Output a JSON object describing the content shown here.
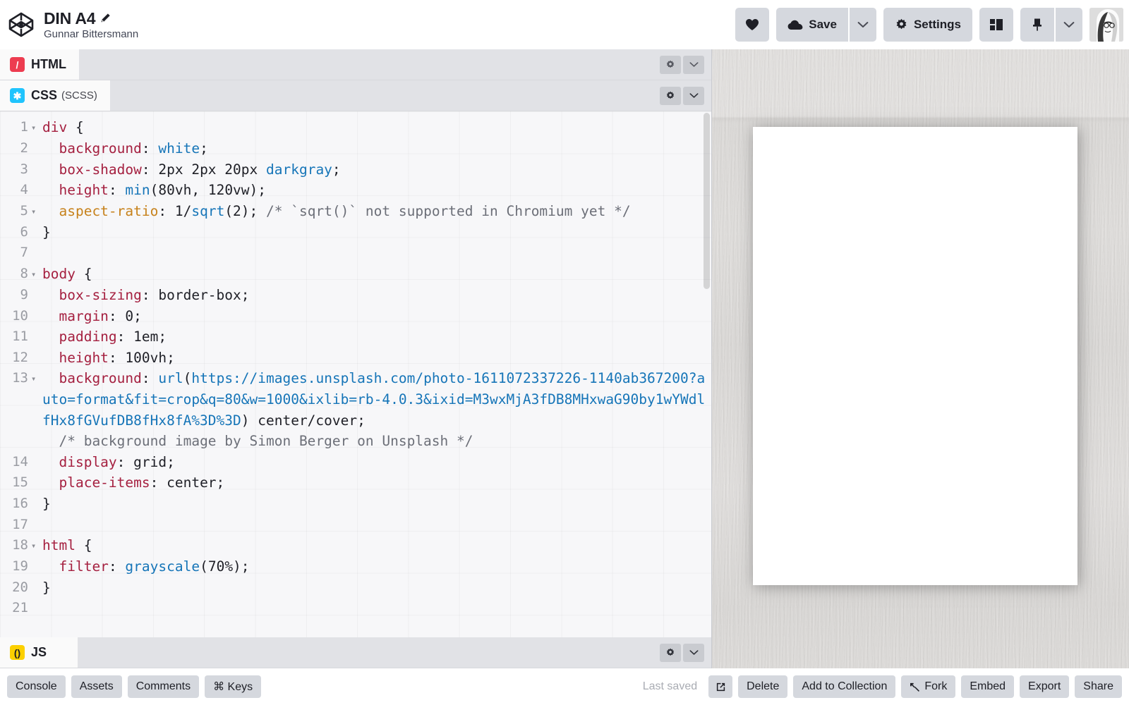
{
  "header": {
    "logo_icon": "codepen-logo-icon",
    "pen_title": "DIN A4",
    "pen_title_edit_icon": "pencil-icon",
    "pen_author": "Gunnar Bittersmann",
    "actions": {
      "love_label": "",
      "love_icon": "heart-icon",
      "save_label": "Save",
      "save_icon": "cloud-icon",
      "save_caret_icon": "chevron-down-icon",
      "settings_label": "Settings",
      "settings_icon": "gear-icon",
      "layout_icon": "layout-panels-icon",
      "pin_icon": "pin-icon",
      "pin_caret_icon": "chevron-down-icon",
      "avatar_icon": "user-avatar"
    }
  },
  "editors": {
    "panes": [
      {
        "id": "html",
        "label": "HTML",
        "sublabel": "",
        "icon": "html-logo-icon",
        "settings_icon": "gear-icon",
        "collapse_icon": "chevron-down-icon"
      },
      {
        "id": "css",
        "label": "CSS",
        "sublabel": "(SCSS)",
        "icon": "css-logo-icon",
        "settings_icon": "gear-icon",
        "collapse_icon": "chevron-down-icon"
      },
      {
        "id": "js",
        "label": "JS",
        "sublabel": "",
        "icon": "js-logo-icon",
        "settings_icon": "gear-icon",
        "collapse_icon": "chevron-down-icon"
      }
    ],
    "css_code": {
      "language": "SCSS",
      "total_lines": 21,
      "lines": [
        {
          "n": 1,
          "fold": true,
          "tokens": [
            {
              "t": "div",
              "c": "k-sel"
            },
            {
              "t": " {",
              "c": "k-punc"
            }
          ]
        },
        {
          "n": 2,
          "fold": false,
          "tokens": [
            {
              "t": "  ",
              "c": "k-punc"
            },
            {
              "t": "background",
              "c": "k-prop"
            },
            {
              "t": ": ",
              "c": "k-punc"
            },
            {
              "t": "white",
              "c": "k-val"
            },
            {
              "t": ";",
              "c": "k-punc"
            }
          ]
        },
        {
          "n": 3,
          "fold": false,
          "tokens": [
            {
              "t": "  ",
              "c": "k-punc"
            },
            {
              "t": "box-shadow",
              "c": "k-prop"
            },
            {
              "t": ": 2px 2px 20px ",
              "c": "k-punc"
            },
            {
              "t": "darkgray",
              "c": "k-val"
            },
            {
              "t": ";",
              "c": "k-punc"
            }
          ]
        },
        {
          "n": 4,
          "fold": false,
          "tokens": [
            {
              "t": "  ",
              "c": "k-punc"
            },
            {
              "t": "height",
              "c": "k-prop"
            },
            {
              "t": ": ",
              "c": "k-punc"
            },
            {
              "t": "min",
              "c": "k-val"
            },
            {
              "t": "(80vh, 120vw);",
              "c": "k-punc"
            }
          ]
        },
        {
          "n": 5,
          "fold": true,
          "tokens": [
            {
              "t": "  ",
              "c": "k-punc"
            },
            {
              "t": "aspect-ratio",
              "c": "k-propu"
            },
            {
              "t": ": 1/",
              "c": "k-punc"
            },
            {
              "t": "sqrt",
              "c": "k-val"
            },
            {
              "t": "(2); ",
              "c": "k-punc"
            },
            {
              "t": "/* `sqrt()` not supported in Chromium yet */",
              "c": "k-com"
            }
          ]
        },
        {
          "n": 6,
          "fold": false,
          "tokens": [
            {
              "t": "}",
              "c": "k-punc"
            }
          ]
        },
        {
          "n": 7,
          "fold": false,
          "tokens": []
        },
        {
          "n": 8,
          "fold": true,
          "tokens": [
            {
              "t": "body",
              "c": "k-sel"
            },
            {
              "t": " {",
              "c": "k-punc"
            }
          ]
        },
        {
          "n": 9,
          "fold": false,
          "tokens": [
            {
              "t": "  ",
              "c": "k-punc"
            },
            {
              "t": "box-sizing",
              "c": "k-prop"
            },
            {
              "t": ": border-box;",
              "c": "k-punc"
            }
          ]
        },
        {
          "n": 10,
          "fold": false,
          "tokens": [
            {
              "t": "  ",
              "c": "k-punc"
            },
            {
              "t": "margin",
              "c": "k-prop"
            },
            {
              "t": ": 0;",
              "c": "k-punc"
            }
          ]
        },
        {
          "n": 11,
          "fold": false,
          "tokens": [
            {
              "t": "  ",
              "c": "k-punc"
            },
            {
              "t": "padding",
              "c": "k-prop"
            },
            {
              "t": ": 1em;",
              "c": "k-punc"
            }
          ]
        },
        {
          "n": 12,
          "fold": false,
          "tokens": [
            {
              "t": "  ",
              "c": "k-punc"
            },
            {
              "t": "height",
              "c": "k-prop"
            },
            {
              "t": ": 100vh;",
              "c": "k-punc"
            }
          ]
        },
        {
          "n": 13,
          "fold": true,
          "tokens": [
            {
              "t": "  ",
              "c": "k-punc"
            },
            {
              "t": "background",
              "c": "k-prop"
            },
            {
              "t": ": ",
              "c": "k-punc"
            },
            {
              "t": "url",
              "c": "k-val"
            },
            {
              "t": "(",
              "c": "k-punc"
            },
            {
              "t": "https://images.unsplash.com/photo-1611072337226-1140ab367200?auto=format&fit=crop&q=80&w=1000&ixlib=rb-4.0.3&ixid=M3wxMjA3fDB8MHxwaG90by1wYWdlfHx8fGVufDB8fHx8fA%3D%3D",
              "c": "k-url"
            },
            {
              "t": ") center/cover;",
              "c": "k-punc"
            }
          ]
        },
        {
          "n": null,
          "fold": false,
          "tokens": [
            {
              "t": "  /* background image by Simon Berger on Unsplash */",
              "c": "k-com"
            }
          ]
        },
        {
          "n": 14,
          "fold": false,
          "tokens": [
            {
              "t": "  ",
              "c": "k-punc"
            },
            {
              "t": "display",
              "c": "k-prop"
            },
            {
              "t": ": grid;",
              "c": "k-punc"
            }
          ]
        },
        {
          "n": 15,
          "fold": false,
          "tokens": [
            {
              "t": "  ",
              "c": "k-punc"
            },
            {
              "t": "place-items",
              "c": "k-prop"
            },
            {
              "t": ": center;",
              "c": "k-punc"
            }
          ]
        },
        {
          "n": 16,
          "fold": false,
          "tokens": [
            {
              "t": "}",
              "c": "k-punc"
            }
          ]
        },
        {
          "n": 17,
          "fold": false,
          "tokens": []
        },
        {
          "n": 18,
          "fold": true,
          "tokens": [
            {
              "t": "html",
              "c": "k-sel"
            },
            {
              "t": " {",
              "c": "k-punc"
            }
          ]
        },
        {
          "n": 19,
          "fold": false,
          "tokens": [
            {
              "t": "  ",
              "c": "k-punc"
            },
            {
              "t": "filter",
              "c": "k-prop"
            },
            {
              "t": ": ",
              "c": "k-punc"
            },
            {
              "t": "grayscale",
              "c": "k-val"
            },
            {
              "t": "(70%);",
              "c": "k-punc"
            }
          ]
        },
        {
          "n": 20,
          "fold": false,
          "tokens": [
            {
              "t": "}",
              "c": "k-punc"
            }
          ]
        },
        {
          "n": 21,
          "fold": false,
          "tokens": []
        }
      ]
    }
  },
  "preview": {
    "description": "white A4 page sheet centered on grayscale wood background",
    "sheet_color": "#ffffff",
    "background_color": "#e6e0dc"
  },
  "footer": {
    "left_buttons": [
      {
        "label": "Console",
        "icon": ""
      },
      {
        "label": "Assets",
        "icon": ""
      },
      {
        "label": "Comments",
        "icon": ""
      },
      {
        "label": "⌘ Keys",
        "icon": "command-icon"
      }
    ],
    "last_saved": "Last saved",
    "right_buttons": [
      {
        "label": "",
        "icon": "external-link-icon"
      },
      {
        "label": "Delete",
        "icon": ""
      },
      {
        "label": "Add to Collection",
        "icon": ""
      },
      {
        "label": "Fork",
        "icon": "fork-icon"
      },
      {
        "label": "Embed",
        "icon": ""
      },
      {
        "label": "Export",
        "icon": ""
      },
      {
        "label": "Share",
        "icon": ""
      }
    ]
  },
  "colors": {
    "toolbar_button": "#d5d8de",
    "editor_bg": "#f7f7f9",
    "html_accent": "#ed3c50",
    "css_accent": "#20c4fd",
    "js_accent": "#fcd000",
    "selector": "#a52040",
    "value": "#1675b8",
    "comment": "#6c6f78",
    "unsupported_prop": "#c7821c"
  }
}
